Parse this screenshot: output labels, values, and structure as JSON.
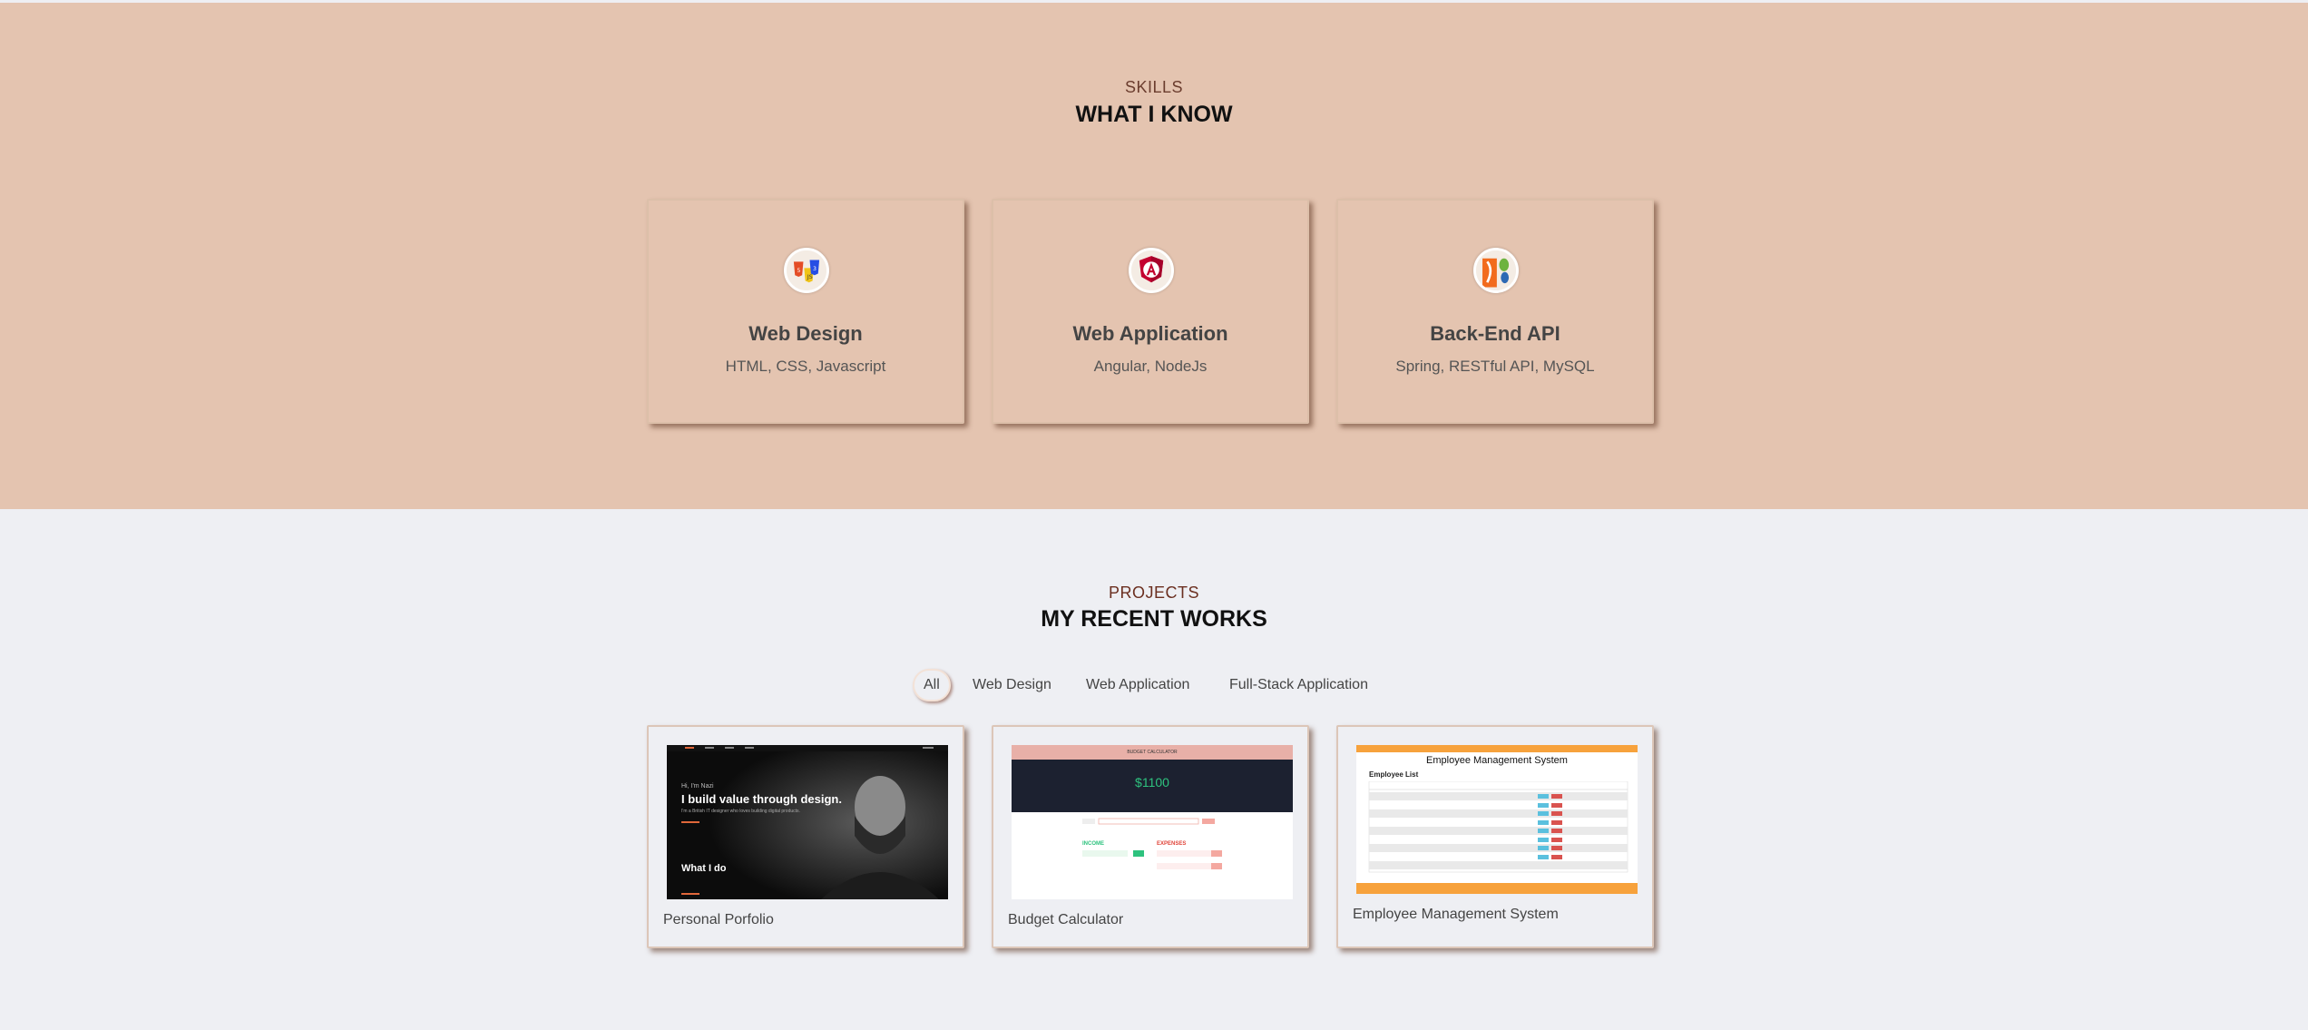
{
  "skills": {
    "eyebrow": "SKILLS",
    "title": "WHAT I KNOW",
    "cards": [
      {
        "name": "Web Design",
        "desc": "HTML, CSS, Javascript",
        "icon": "html-css-js-icon"
      },
      {
        "name": "Web Application",
        "desc": "Angular, NodeJs",
        "icon": "angular-icon"
      },
      {
        "name": "Back-End API",
        "desc": "Spring, RESTful API, MySQL",
        "icon": "spring-mysql-icon"
      }
    ]
  },
  "projects": {
    "eyebrow": "PROJECTS",
    "title": "MY RECENT WORKS",
    "filters": [
      "All",
      "Web Design",
      "Web Application",
      "Full-Stack Application"
    ],
    "active_filter": "All",
    "items": [
      {
        "name": "Personal Porfolio",
        "thumb": {
          "greeting": "Hi, I'm Nazi",
          "headline": "I build value through design.",
          "subline": "I'm a British IT designer who loves building digital products.",
          "footer": "What I do"
        }
      },
      {
        "name": "Budget Calculator",
        "thumb": {
          "header": "BUDGET CALCULATOR",
          "amount": "$1100",
          "income_label": "INCOME",
          "expenses_label": "EXPENSES"
        }
      },
      {
        "name": "Employee Management System",
        "thumb": {
          "title": "Employee Management System",
          "list_title": "Employee List"
        }
      }
    ]
  },
  "colors": {
    "skills_bg": "#e4c4b0",
    "projects_bg": "#eeeff3",
    "accent": "#6b3d2e"
  }
}
